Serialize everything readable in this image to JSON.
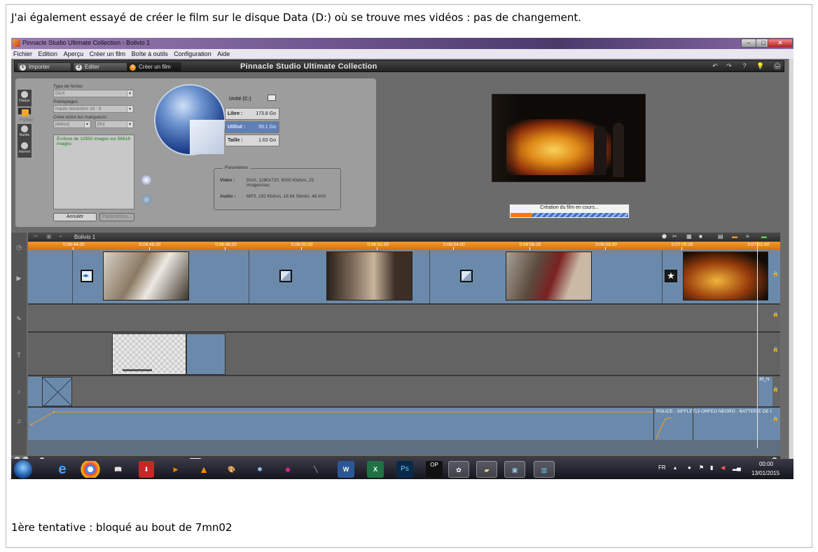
{
  "caption_top": "J'ai également essayé de créer le film sur le disque Data (D:) où se trouve mes vidéos : pas de changement.",
  "caption_bottom": "1ère tentative : bloqué au bout de 7mn02",
  "window": {
    "title": "Pinnacle Studio Ultimate Collection - Bolivio 1",
    "minimize": "–",
    "maximize": "□",
    "close": "✕"
  },
  "menu": [
    "Fichier",
    "Edition",
    "Aperçu",
    "Créer un film",
    "Boîte à outils",
    "Configuration",
    "Aide"
  ],
  "tabs": [
    {
      "num": "1",
      "label": "Importer"
    },
    {
      "num": "2",
      "label": "Editer"
    },
    {
      "num": "3",
      "label": "Créer un film"
    }
  ],
  "brand": "Pinnacle Studio Ultimate Collection",
  "toolbar_icons": [
    "undo-icon",
    "redo-icon",
    "help-icon",
    "tip-icon",
    "camera-icon"
  ],
  "toolbar_glyphs": [
    "↶",
    "↷",
    "?",
    "💡",
    "🖨"
  ],
  "side_tabs": [
    "Disque",
    "Fichier",
    "Bande",
    "Internet"
  ],
  "output": {
    "file_type_label": "Type de fichier",
    "file_type_value": "DivX",
    "presets_label": "Préréglages",
    "presets_value": "Haute résolution 16 : 9",
    "markers_label": "Créer entre les marqueurs :",
    "marker_start": "[début]",
    "marker_end": "[fin]",
    "log_text": "Écriture de 10550 images sur 56618 images",
    "cancel_button": "Annuler",
    "params_button": "Paramètres...",
    "drive_label": "Unité (C:)",
    "free_label": "Libre :",
    "free_value": "173.8 Go",
    "used_label": "Utilisé :",
    "used_value": "59.1 Go",
    "size_label": "Taille :",
    "size_value": "1.63 Go",
    "params_title": "Paramètres",
    "video_label": "Vidéo :",
    "video_value": "DivX, 1280x720, 6000 Kbits/s, 25 Images/sec",
    "audio_label": "Audio :",
    "audio_value": "MP3, 192 Kbits/s, 16 bit Stéréo, 48 kHz",
    "progress_text": "Création du film en cours...",
    "progress_fraction": 0.186
  },
  "timeline": {
    "project_name": "Bolivio 1",
    "ruler": [
      "0:06:44.00",
      "0:06:46.00",
      "0:06:48.00",
      "0:06:50.00",
      "0:06:52.00",
      "0:06:54.00",
      "0:06:56.00",
      "0:06:58.00",
      "0:07:00.00",
      "0:07:02.00"
    ],
    "audio_clip_label": "35_N",
    "music_labels": [
      "POLICE - SIFFLET",
      "13 ORFEO NEGRO - BATTERIE DE CA"
    ]
  },
  "taskbar": {
    "language": "FR",
    "time": "00:00",
    "date": "13/01/2015"
  }
}
